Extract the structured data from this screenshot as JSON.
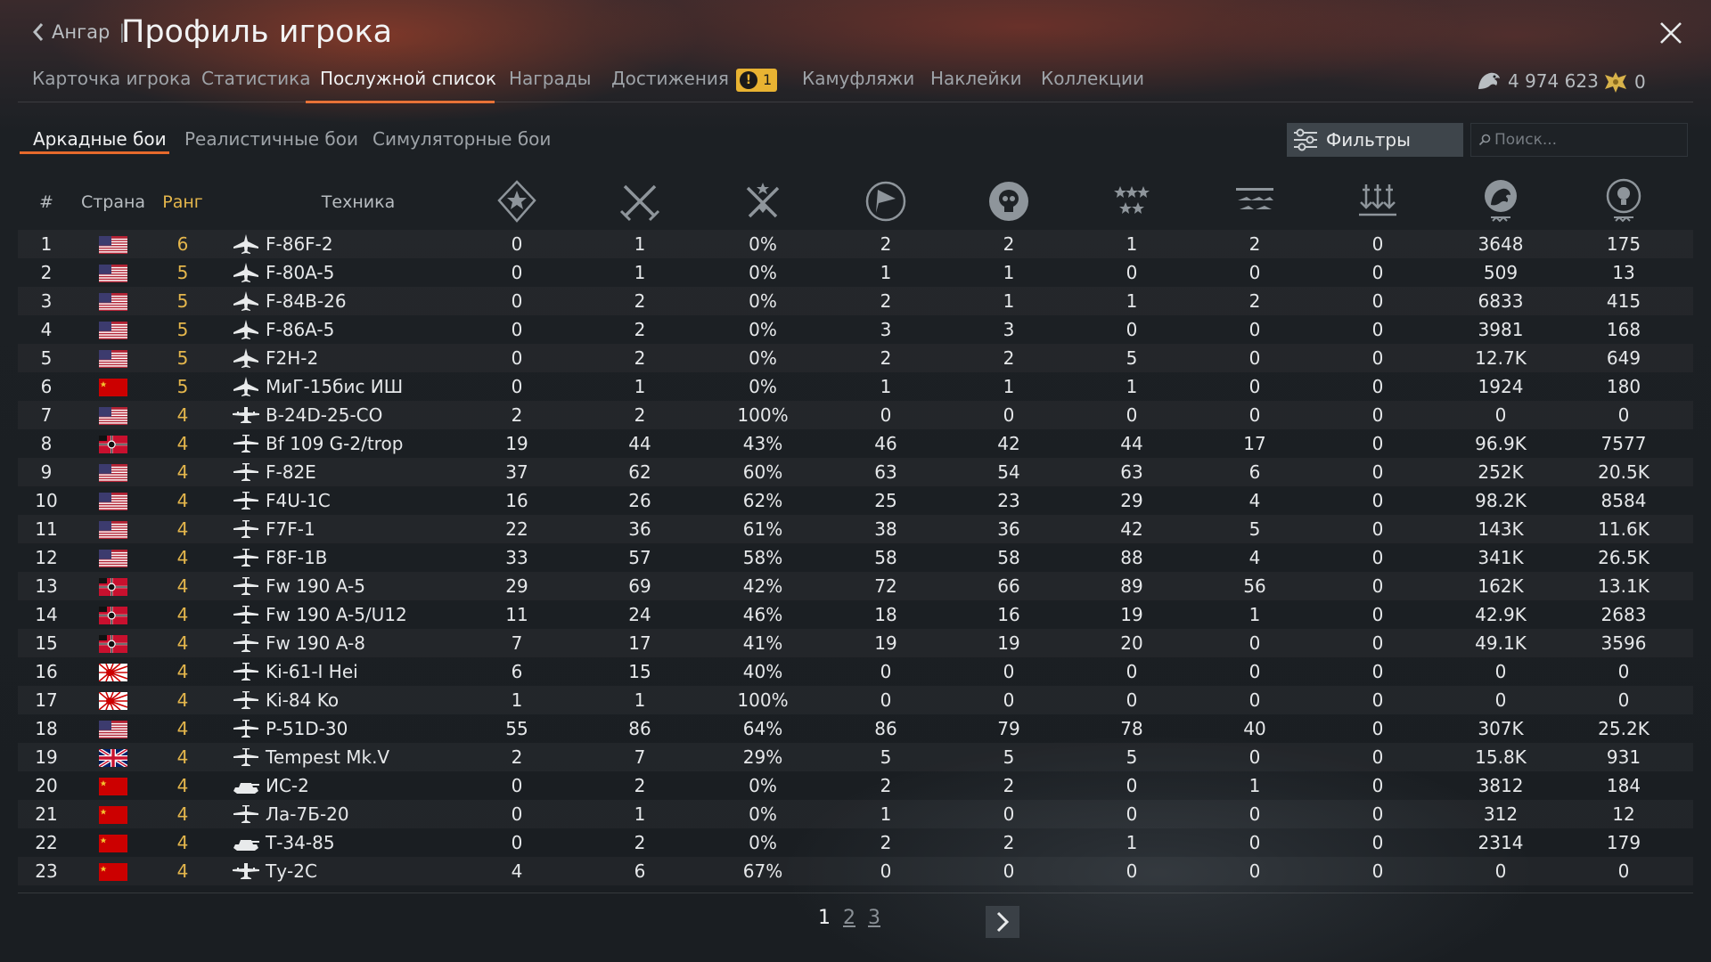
{
  "header": {
    "back_label": "Ангар",
    "title": "Профиль игрока",
    "tabs": [
      {
        "label": "Карточка игрока",
        "active": false
      },
      {
        "label": "Статистика",
        "active": false
      },
      {
        "label": "Послужной список",
        "active": true
      },
      {
        "label": "Награды",
        "active": false
      },
      {
        "label": "Достижения",
        "active": false,
        "badge": "1"
      },
      {
        "label": "Камуфляжи",
        "active": false
      },
      {
        "label": "Наклейки",
        "active": false
      },
      {
        "label": "Коллекции",
        "active": false
      }
    ],
    "silver_lions": "4 974 623",
    "golden_eagles": "0"
  },
  "modes": [
    {
      "label": "Аркадные бои",
      "active": true
    },
    {
      "label": "Реалистичные бои",
      "active": false
    },
    {
      "label": "Симуляторные бои",
      "active": false
    }
  ],
  "filters_label": "Фильтры",
  "search_placeholder": "Поиск...",
  "columns": {
    "num": "#",
    "country": "Страна",
    "rank": "Ранг",
    "vehicle": "Техника",
    "icon_columns": [
      "battles-star-icon",
      "crossed-swords-icon",
      "victories-swords-icon",
      "respawns-flag-icon",
      "deaths-skull-icon",
      "air-kills-stars-icon",
      "ground-kills-icon",
      "naval-kills-icon",
      "silver-lions-icon",
      "research-points-icon"
    ]
  },
  "rows": [
    {
      "n": "1",
      "country": "usa",
      "rank": "6",
      "type": "jet",
      "vehicle": "F-86F-2",
      "v": [
        "0",
        "1",
        "0%",
        "2",
        "2",
        "1",
        "2",
        "0",
        "3648",
        "175"
      ]
    },
    {
      "n": "2",
      "country": "usa",
      "rank": "5",
      "type": "jet",
      "vehicle": "F-80A-5",
      "v": [
        "0",
        "1",
        "0%",
        "1",
        "1",
        "0",
        "0",
        "0",
        "509",
        "13"
      ]
    },
    {
      "n": "3",
      "country": "usa",
      "rank": "5",
      "type": "jet",
      "vehicle": "F-84B-26",
      "v": [
        "0",
        "2",
        "0%",
        "2",
        "1",
        "1",
        "2",
        "0",
        "6833",
        "415"
      ]
    },
    {
      "n": "4",
      "country": "usa",
      "rank": "5",
      "type": "jet",
      "vehicle": "F-86A-5",
      "v": [
        "0",
        "2",
        "0%",
        "3",
        "3",
        "0",
        "0",
        "0",
        "3981",
        "168"
      ]
    },
    {
      "n": "5",
      "country": "usa",
      "rank": "5",
      "type": "jet",
      "vehicle": "F2H-2",
      "v": [
        "0",
        "2",
        "0%",
        "2",
        "2",
        "5",
        "0",
        "0",
        "12.7K",
        "649"
      ]
    },
    {
      "n": "6",
      "country": "ussr",
      "rank": "5",
      "type": "jet",
      "vehicle": "МиГ-15бис ИШ",
      "v": [
        "0",
        "1",
        "0%",
        "1",
        "1",
        "1",
        "0",
        "0",
        "1924",
        "180"
      ]
    },
    {
      "n": "7",
      "country": "usa",
      "rank": "4",
      "type": "bomber",
      "vehicle": "B-24D-25-CO",
      "v": [
        "2",
        "2",
        "100%",
        "0",
        "0",
        "0",
        "0",
        "0",
        "0",
        "0"
      ]
    },
    {
      "n": "8",
      "country": "germany",
      "rank": "4",
      "type": "fighter",
      "vehicle": "Bf 109 G-2/trop",
      "v": [
        "19",
        "44",
        "43%",
        "46",
        "42",
        "44",
        "17",
        "0",
        "96.9K",
        "7577"
      ]
    },
    {
      "n": "9",
      "country": "usa",
      "rank": "4",
      "type": "fighter",
      "vehicle": "F-82E",
      "v": [
        "37",
        "62",
        "60%",
        "63",
        "54",
        "63",
        "6",
        "0",
        "252K",
        "20.5K"
      ]
    },
    {
      "n": "10",
      "country": "usa",
      "rank": "4",
      "type": "fighter",
      "vehicle": "F4U-1C",
      "v": [
        "16",
        "26",
        "62%",
        "25",
        "23",
        "29",
        "4",
        "0",
        "98.2K",
        "8584"
      ]
    },
    {
      "n": "11",
      "country": "usa",
      "rank": "4",
      "type": "fighter",
      "vehicle": "F7F-1",
      "v": [
        "22",
        "36",
        "61%",
        "38",
        "36",
        "42",
        "5",
        "0",
        "143K",
        "11.6K"
      ]
    },
    {
      "n": "12",
      "country": "usa",
      "rank": "4",
      "type": "fighter",
      "vehicle": "F8F-1B",
      "v": [
        "33",
        "57",
        "58%",
        "58",
        "58",
        "88",
        "4",
        "0",
        "341K",
        "26.5K"
      ]
    },
    {
      "n": "13",
      "country": "germany",
      "rank": "4",
      "type": "fighter",
      "vehicle": "Fw 190 A-5",
      "v": [
        "29",
        "69",
        "42%",
        "72",
        "66",
        "89",
        "56",
        "0",
        "162K",
        "13.1K"
      ]
    },
    {
      "n": "14",
      "country": "germany",
      "rank": "4",
      "type": "fighter",
      "vehicle": "Fw 190 A-5/U12",
      "v": [
        "11",
        "24",
        "46%",
        "18",
        "16",
        "19",
        "1",
        "0",
        "42.9K",
        "2683"
      ]
    },
    {
      "n": "15",
      "country": "germany",
      "rank": "4",
      "type": "fighter",
      "vehicle": "Fw 190 A-8",
      "v": [
        "7",
        "17",
        "41%",
        "19",
        "19",
        "20",
        "0",
        "0",
        "49.1K",
        "3596"
      ]
    },
    {
      "n": "16",
      "country": "japan",
      "rank": "4",
      "type": "fighter",
      "vehicle": "Ki-61-I Hei",
      "v": [
        "6",
        "15",
        "40%",
        "0",
        "0",
        "0",
        "0",
        "0",
        "0",
        "0"
      ]
    },
    {
      "n": "17",
      "country": "japan",
      "rank": "4",
      "type": "fighter",
      "vehicle": "Ki-84 Ko",
      "v": [
        "1",
        "1",
        "100%",
        "0",
        "0",
        "0",
        "0",
        "0",
        "0",
        "0"
      ]
    },
    {
      "n": "18",
      "country": "usa",
      "rank": "4",
      "type": "fighter",
      "vehicle": "P-51D-30",
      "v": [
        "55",
        "86",
        "64%",
        "86",
        "79",
        "78",
        "40",
        "0",
        "307K",
        "25.2K"
      ]
    },
    {
      "n": "19",
      "country": "britain",
      "rank": "4",
      "type": "fighter",
      "vehicle": "Tempest Mk.V",
      "v": [
        "2",
        "7",
        "29%",
        "5",
        "5",
        "5",
        "0",
        "0",
        "15.8K",
        "931"
      ]
    },
    {
      "n": "20",
      "country": "ussr",
      "rank": "4",
      "type": "tank",
      "vehicle": "ИС-2",
      "v": [
        "0",
        "2",
        "0%",
        "2",
        "2",
        "0",
        "1",
        "0",
        "3812",
        "184"
      ]
    },
    {
      "n": "21",
      "country": "ussr",
      "rank": "4",
      "type": "fighter",
      "vehicle": "Ла-7Б-20",
      "v": [
        "0",
        "1",
        "0%",
        "1",
        "0",
        "0",
        "0",
        "0",
        "312",
        "12"
      ]
    },
    {
      "n": "22",
      "country": "ussr",
      "rank": "4",
      "type": "tank",
      "vehicle": "Т-34-85",
      "v": [
        "0",
        "2",
        "0%",
        "2",
        "2",
        "1",
        "0",
        "0",
        "2314",
        "179"
      ]
    },
    {
      "n": "23",
      "country": "ussr",
      "rank": "4",
      "type": "bomber",
      "vehicle": "Ту-2С",
      "v": [
        "4",
        "6",
        "67%",
        "0",
        "0",
        "0",
        "0",
        "0",
        "0",
        "0"
      ]
    }
  ],
  "pagination": {
    "pages": [
      "1",
      "2",
      "3"
    ],
    "current": "1"
  },
  "colors": {
    "accent": "#e66a2c",
    "rank": "#e4b64c",
    "badge": "#e8b332"
  }
}
